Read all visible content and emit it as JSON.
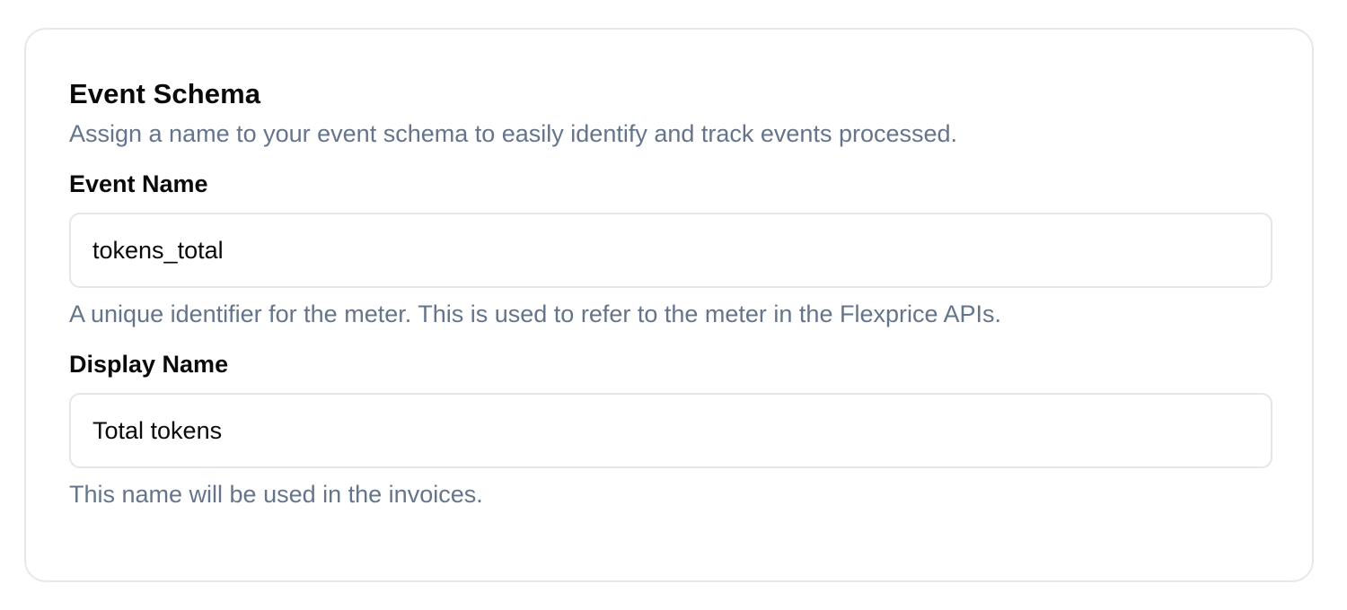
{
  "section": {
    "title": "Event Schema",
    "subtitle": "Assign a name to your event schema to easily identify and track events processed."
  },
  "fields": {
    "event_name": {
      "label": "Event Name",
      "value": "tokens_total",
      "help": "A unique identifier for the meter. This is used to refer to the meter in the Flexprice APIs."
    },
    "display_name": {
      "label": "Display Name",
      "value": "Total tokens",
      "help": "This name will be used in the invoices."
    }
  },
  "colors": {
    "muted_text": "#64748b",
    "border": "#e4e6ea",
    "text": "#0a0a0a"
  }
}
